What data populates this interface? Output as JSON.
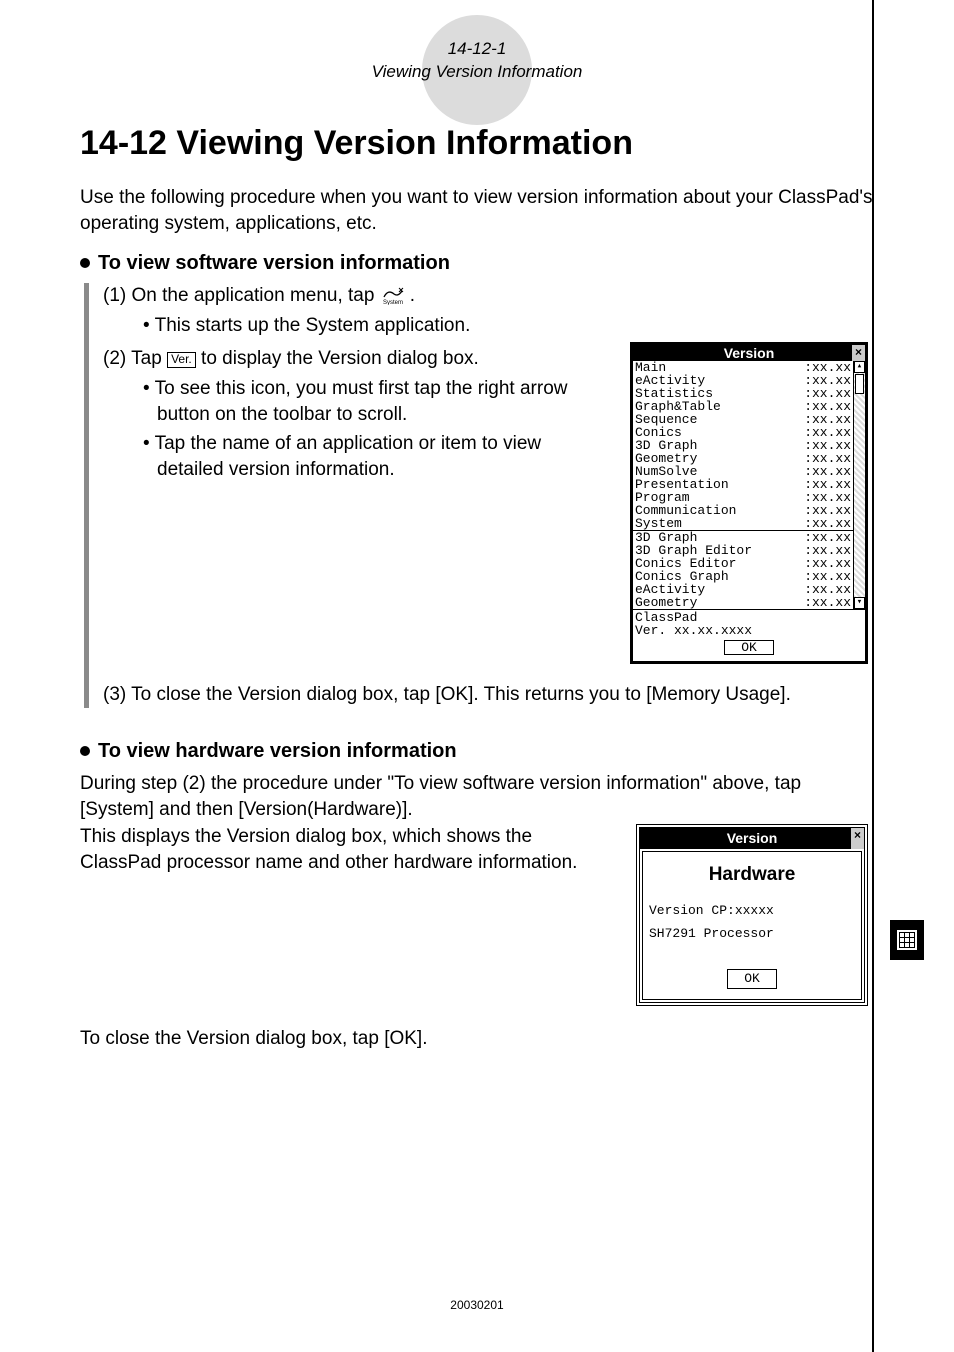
{
  "header": {
    "section_code": "14-12-1",
    "section_subtitle": "Viewing Version Information"
  },
  "title": "14-12  Viewing Version Information",
  "intro": "Use the following procedure when you want to view version information about your ClassPad's operating system, applications, etc.",
  "software": {
    "heading": "To view software version information",
    "step1_prefix": "(1) On the application menu, tap ",
    "step1_suffix": ".",
    "step1_icon_name": "system-app-icon",
    "step1_sub": "This starts up the System application.",
    "step2_prefix": "(2) Tap ",
    "step2_badge": "Ver.",
    "step2_suffix": " to display the Version dialog box.",
    "step2_sub1": "To see this icon, you must first tap the right arrow button on the toolbar to scroll.",
    "step2_sub2": "Tap the name of an application or item to view detailed version information.",
    "step3": "(3) To close the Version dialog box, tap [OK].  This returns you to [Memory Usage]."
  },
  "hardware": {
    "heading": "To view hardware version information",
    "para1": "During step (2) the procedure under \"To view software version information\" above, tap [System] and then [Version(Hardware)].",
    "para2": "This displays the Version dialog box, which shows the ClassPad processor name and other hardware information.",
    "closing": "To close the Version dialog box, tap [OK]."
  },
  "version_dialog": {
    "title": "Version",
    "group1": [
      {
        "name": "Main",
        "ver": ":xx.xx"
      },
      {
        "name": "eActivity",
        "ver": ":xx.xx"
      },
      {
        "name": "Statistics",
        "ver": ":xx.xx"
      },
      {
        "name": "Graph&Table",
        "ver": ":xx.xx"
      },
      {
        "name": "Sequence",
        "ver": ":xx.xx"
      },
      {
        "name": "Conics",
        "ver": ":xx.xx"
      },
      {
        "name": "3D Graph",
        "ver": ":xx.xx"
      },
      {
        "name": "Geometry",
        "ver": ":xx.xx"
      },
      {
        "name": "NumSolve",
        "ver": ":xx.xx"
      },
      {
        "name": "Presentation",
        "ver": ":xx.xx"
      },
      {
        "name": "Program",
        "ver": ":xx.xx"
      },
      {
        "name": "Communication",
        "ver": ":xx.xx"
      },
      {
        "name": "System",
        "ver": ":xx.xx"
      }
    ],
    "group2": [
      {
        "name": "3D Graph",
        "ver": ":xx.xx"
      },
      {
        "name": "3D Graph Editor",
        "ver": ":xx.xx"
      },
      {
        "name": "Conics Editor",
        "ver": ":xx.xx"
      },
      {
        "name": "Conics Graph",
        "ver": ":xx.xx"
      },
      {
        "name": "eActivity",
        "ver": ":xx.xx"
      },
      {
        "name": "Geometry",
        "ver": ":xx.xx"
      }
    ],
    "footer_line1": "ClassPad",
    "footer_line2": "Ver. xx.xx.xxxx",
    "ok": "OK"
  },
  "hw_dialog": {
    "title": "Version",
    "subtitle": "Hardware",
    "line1": "Version CP:xxxxx",
    "line2": "SH7291 Processor",
    "ok": "OK"
  },
  "footer_code": "20030201"
}
